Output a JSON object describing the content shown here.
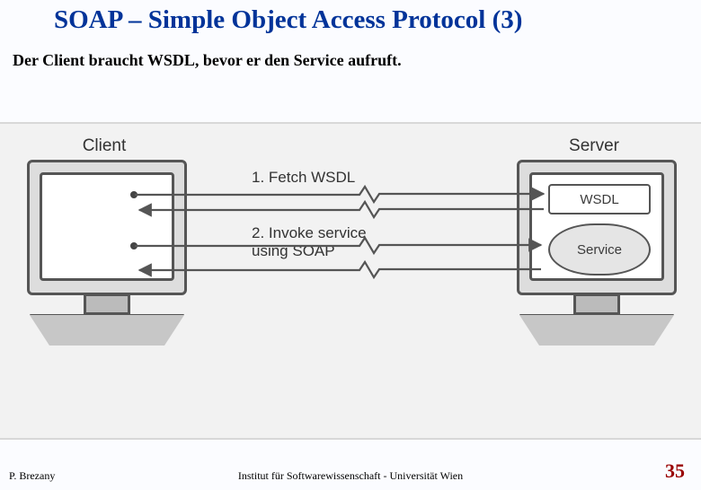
{
  "slide": {
    "title": "SOAP – Simple Object Access Protocol (3)",
    "subtitle": "Der Client braucht WSDL, bevor er den Service aufruft.",
    "page_number": "35"
  },
  "footer": {
    "author": "P. Brezany",
    "institute": "Institut für Softwarewissenschaft - Universität Wien"
  },
  "figure": {
    "client_label": "Client",
    "server_label": "Server",
    "wsdl_label": "WSDL",
    "service_label": "Service",
    "step1": "1. Fetch WSDL",
    "step2_line1": "2. Invoke service",
    "step2_line2": "using SOAP"
  }
}
